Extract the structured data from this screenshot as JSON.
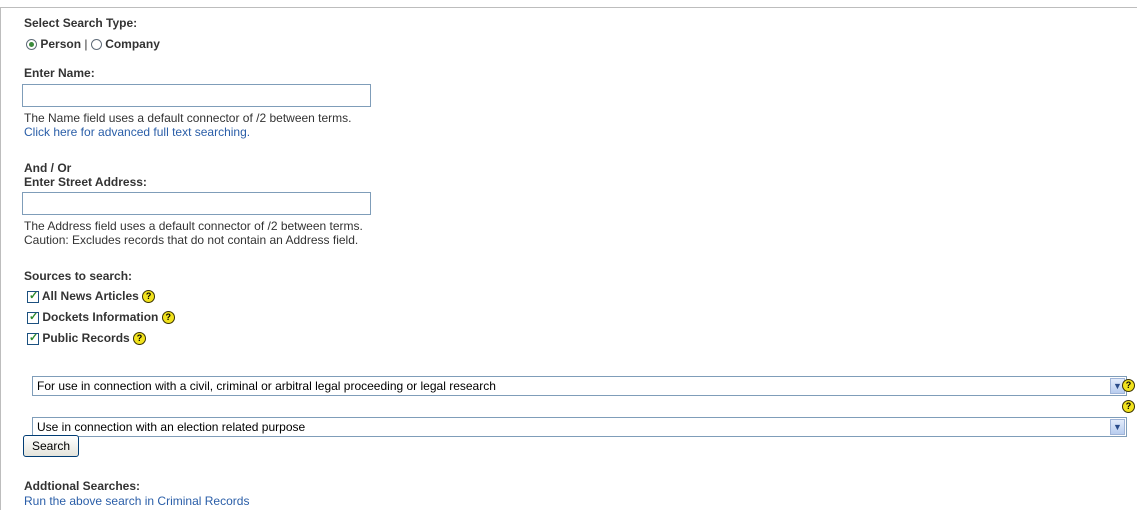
{
  "search_type": {
    "label": "Select Search Type:",
    "person_label": "Person",
    "separator": "|",
    "company_label": "Company",
    "selected": "Person"
  },
  "name_section": {
    "label": "Enter Name:",
    "value": "",
    "help_text": "The Name field uses a default connector of /2 between terms.",
    "advanced_link": "Click here for advanced full text searching."
  },
  "address_section": {
    "and_or": "And / Or",
    "label": "Enter Street Address:",
    "value": "",
    "help_text": "The Address field uses a default connector of /2 between terms.",
    "caution_text": "Caution: Excludes records that do not contain an Address field."
  },
  "sources": {
    "label": "Sources to search:",
    "items": [
      {
        "label": "All News Articles",
        "checked": true
      },
      {
        "label": "Dockets Information",
        "checked": true
      },
      {
        "label": "Public Records",
        "checked": true
      }
    ]
  },
  "permissible_use": {
    "selects": [
      {
        "value": "For use in connection with a civil, criminal or arbitral legal proceeding or legal research"
      },
      {
        "value": "Use in connection with an election related purpose"
      }
    ]
  },
  "search_button": "Search",
  "additional": {
    "label": "Addtional Searches:",
    "link": "Run the above search in Criminal Records"
  },
  "icons": {
    "help": "help-question-icon",
    "dropdown": "chevron-down-icon",
    "check": "checkmark-icon"
  },
  "colors": {
    "link": "#2a5ea8",
    "help_icon": "#f1e21c",
    "check": "#2c8a2c",
    "input_border": "#7f9db9"
  }
}
